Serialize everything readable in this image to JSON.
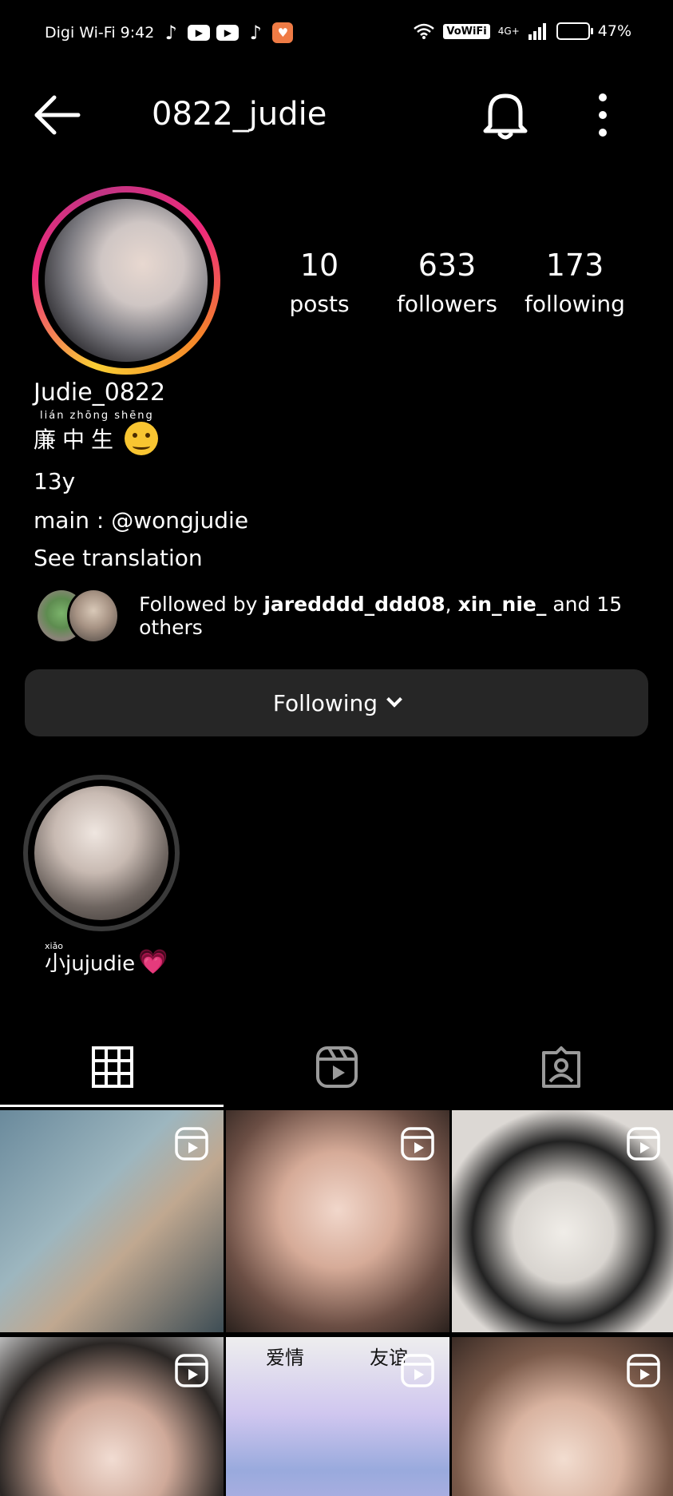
{
  "status_bar": {
    "carrier_time": "Digi Wi-Fi 9:42",
    "battery": "47%",
    "vowifi": "VoWiFi",
    "network": "4G+"
  },
  "header": {
    "title": "0822_judie"
  },
  "stats": {
    "posts_count": "10",
    "posts_label": "posts",
    "followers_count": "633",
    "followers_label": "followers",
    "following_count": "173",
    "following_label": "following"
  },
  "bio": {
    "name": "Judie_0822",
    "pinyin": "lián  zhōng shēng",
    "chinese": "廉中生",
    "age": "13y",
    "main_account": "main : @wongjudie",
    "see_translation": "See translation"
  },
  "followed_by": {
    "prefix": "Followed by ",
    "user1": "jaredddd_ddd08",
    "separator": ", ",
    "user2": "xin_nie_",
    "suffix": " and 15 others"
  },
  "follow_button": {
    "label": "Following"
  },
  "highlight": {
    "pinyin": "xiǎo",
    "label": "小jujudie",
    "heart": "💗"
  },
  "grid_captions": {
    "cell5_left": "爱情",
    "cell5_right": "友谊"
  },
  "colors": {
    "button_bg": "#262626",
    "background": "#000000"
  },
  "icons": {
    "back": "back-arrow-icon",
    "bell": "bell-icon",
    "more": "more-vertical-icon",
    "grid": "grid-icon",
    "reels": "reels-icon",
    "tagged": "tagged-icon"
  }
}
